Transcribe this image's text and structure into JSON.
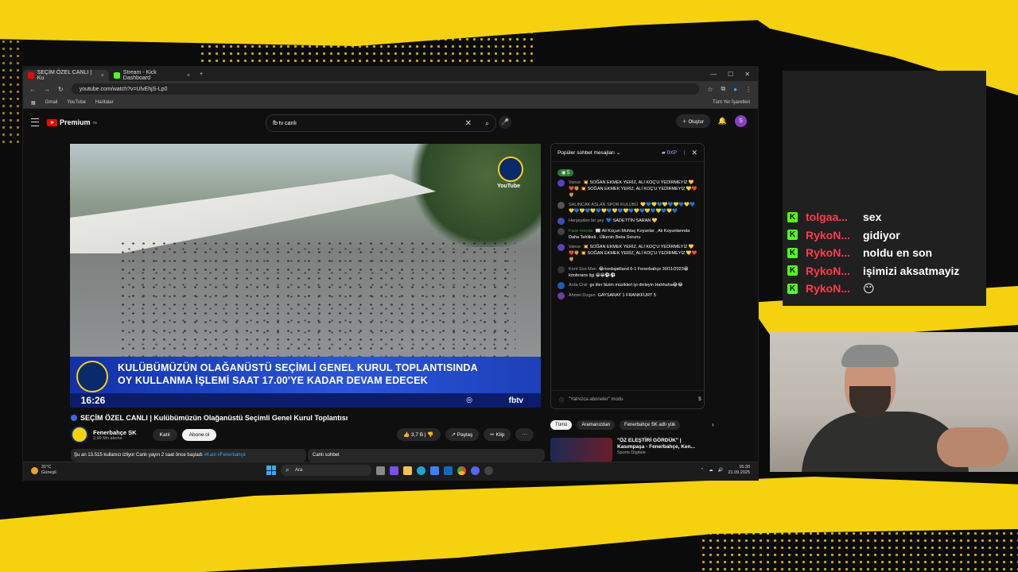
{
  "colors": {
    "accent_yellow": "#f5d10f",
    "yt_red": "#ff0000",
    "kick_green": "#53fc18"
  },
  "browser": {
    "tabs": [
      {
        "label": "SEÇİM ÖZEL CANLI | Ku",
        "icon": "youtube-icon",
        "active": true
      },
      {
        "label": "Stream - Kick Dashboard",
        "icon": "kick-icon",
        "active": false
      }
    ],
    "new_tab": "+",
    "url": "youtube.com/watch?v=UlvEhjS-Lp0",
    "bookmarks": [
      "Gmail",
      "YouTube",
      "Haritalar"
    ],
    "bookmarks_right": "Tüm Yer İşaretleri"
  },
  "youtube": {
    "logo_text": "Premium",
    "logo_sup": "TR",
    "search_value": "fb tv canlı",
    "create_label": "Oluştur",
    "avatar_letter": "S",
    "video": {
      "watermark": "YouTube",
      "lower_third_line1": "KULÜBÜMÜZÜN OLAĞANÜSTÜ SEÇİMLİ GENEL KURUL TOPLANTISINDA",
      "lower_third_line2": "OY KULLANMA İŞLEMİ SAAT 17.00'YE KADAR DEVAM EDECEK",
      "time": "16:26",
      "channel_brand": "fbtv"
    },
    "title": "SEÇİM ÖZEL CANLI | Kulübümüzün Olağanüstü Seçimli Genel Kurul Toplantısı",
    "channel": {
      "name": "Fenerbahçe SK",
      "subs": "2,99 Mn abone",
      "join": "Katıl",
      "subscribe": "Abone ol"
    },
    "actions": {
      "likes": "3,7 B",
      "share": "Paylaş",
      "clip": "Klip",
      "more": "···"
    },
    "description": {
      "text": "Şu an 13.515 kullanıcı izliyor  Canlı yayın 2 saat önce başladı",
      "tags": "#Katıl #Fenerbahçe"
    },
    "live_chat_label": "Canlı sohbet"
  },
  "chat": {
    "header": "Popüler sohbet mesajları",
    "points": "0XP",
    "pinned_count": "5",
    "messages": [
      {
        "name": "Vance",
        "text": "💥 SOĞAN EKMEK YERİZ, ALİ KOÇ'U YEDİRMEYİZ 💛❤️🦁 💥 SOĞAN EKMEK YERİZ, ALİ KOÇ'U YEDİRMEYİZ 💛❤️🦁",
        "color": "#5a3fc0"
      },
      {
        "name": "SALINCAK ASLAN SPOR KULÜBÜ",
        "text": "💛💙💛💙💛💙💛💙💛💙💛💙💛💙💛💙💛💙💛💙💛💙💛💙💛💙💛💙💛💙",
        "color": "#555555"
      },
      {
        "name": "Herşeyden bir şey",
        "text": "💙 SADETTİN SARAN 💛",
        "color": "#3f51b5"
      },
      {
        "name": "Fase mende",
        "text": "📰 Ali Koçun Muhtaç Koyunlar , Ak Koyunlarında Daha Tehlikeli . Ülkenin Beka Sorunu",
        "color": "#444444",
        "green": true
      },
      {
        "name": "Vance",
        "text": "💥 SOĞAN EKMEK YERİZ, ALİ KOÇ'U YEDİRMEYİZ 💛❤️🦁 💥 SOĞAN EKMEK YERİZ, ALİ KOÇ'U YEDİRMEYİZ 💛❤️🦁",
        "color": "#5a3fc0"
      },
      {
        "name": "Kont Soo Man",
        "text": "😂nordsjælland 6-1 Fenerbahçe 30/11/2023😁 konferans ligi 😁😁⚽⚽",
        "color": "#333333"
      },
      {
        "name": "Arda Civil",
        "text": "gs liler bizim müzikleri iyi dinleyin Hahhaha😂😂",
        "color": "#1e5bb8"
      },
      {
        "name": "Ahmet Dogan",
        "text": "GAYSARAY 1 FRANKFURT 5",
        "color": "#6b3fa0"
      }
    ],
    "input_mode": "\"Yalnızca aboneler\" modu"
  },
  "recommendations": {
    "tabs": [
      "Tümü",
      "Aramanızdan",
      "Fenerbahçe SK adlı yük"
    ],
    "video_title": "\"ÖZ ELEŞTİRİ GÖRDÜK\" | Kasımpaşa - Fenerbahçe, Ken...",
    "video_channel": "Sports Digitale"
  },
  "taskbar": {
    "weather_temp": "31°C",
    "weather_desc": "Güneşli",
    "search": "Ara",
    "time": "16:30",
    "date": "21.09.2025"
  },
  "overlay_chat": [
    {
      "user": "tolgaa...",
      "text": "sex"
    },
    {
      "user": "RykoN...",
      "text": "gidiyor"
    },
    {
      "user": "RykoN...",
      "text": "noldu en son"
    },
    {
      "user": "RykoN...",
      "text": "işimizi aksatmayiz"
    },
    {
      "user": "RykoN...",
      "text": "😶"
    }
  ],
  "kick_badge": "K"
}
